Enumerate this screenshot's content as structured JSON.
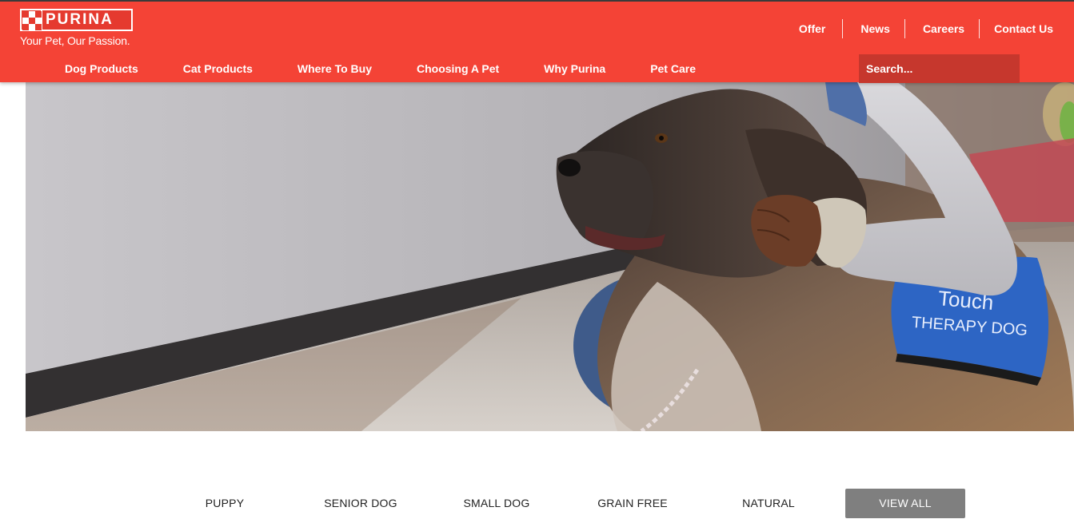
{
  "brand": {
    "name": "PURINA",
    "tagline": "Your Pet, Our Passion.",
    "colors": {
      "primary": "#f44336",
      "search_bg": "#c6372d",
      "view_all_bg": "#7f7f7f"
    }
  },
  "utility_nav": [
    "Offer",
    "News",
    "Careers",
    "Contact Us"
  ],
  "main_nav": [
    "Dog Products",
    "Cat Products",
    "Where To Buy",
    "Choosing A Pet",
    "Why Purina",
    "Pet Care"
  ],
  "search": {
    "placeholder": "Search..."
  },
  "hero": {
    "image": "therapy-dog-photo",
    "vest_text_top": "Touch",
    "vest_text": "THERAPY DOG"
  },
  "filters": [
    "PUPPY",
    "SENIOR DOG",
    "SMALL DOG",
    "GRAIN FREE",
    "NATURAL"
  ],
  "view_all": "VIEW ALL"
}
